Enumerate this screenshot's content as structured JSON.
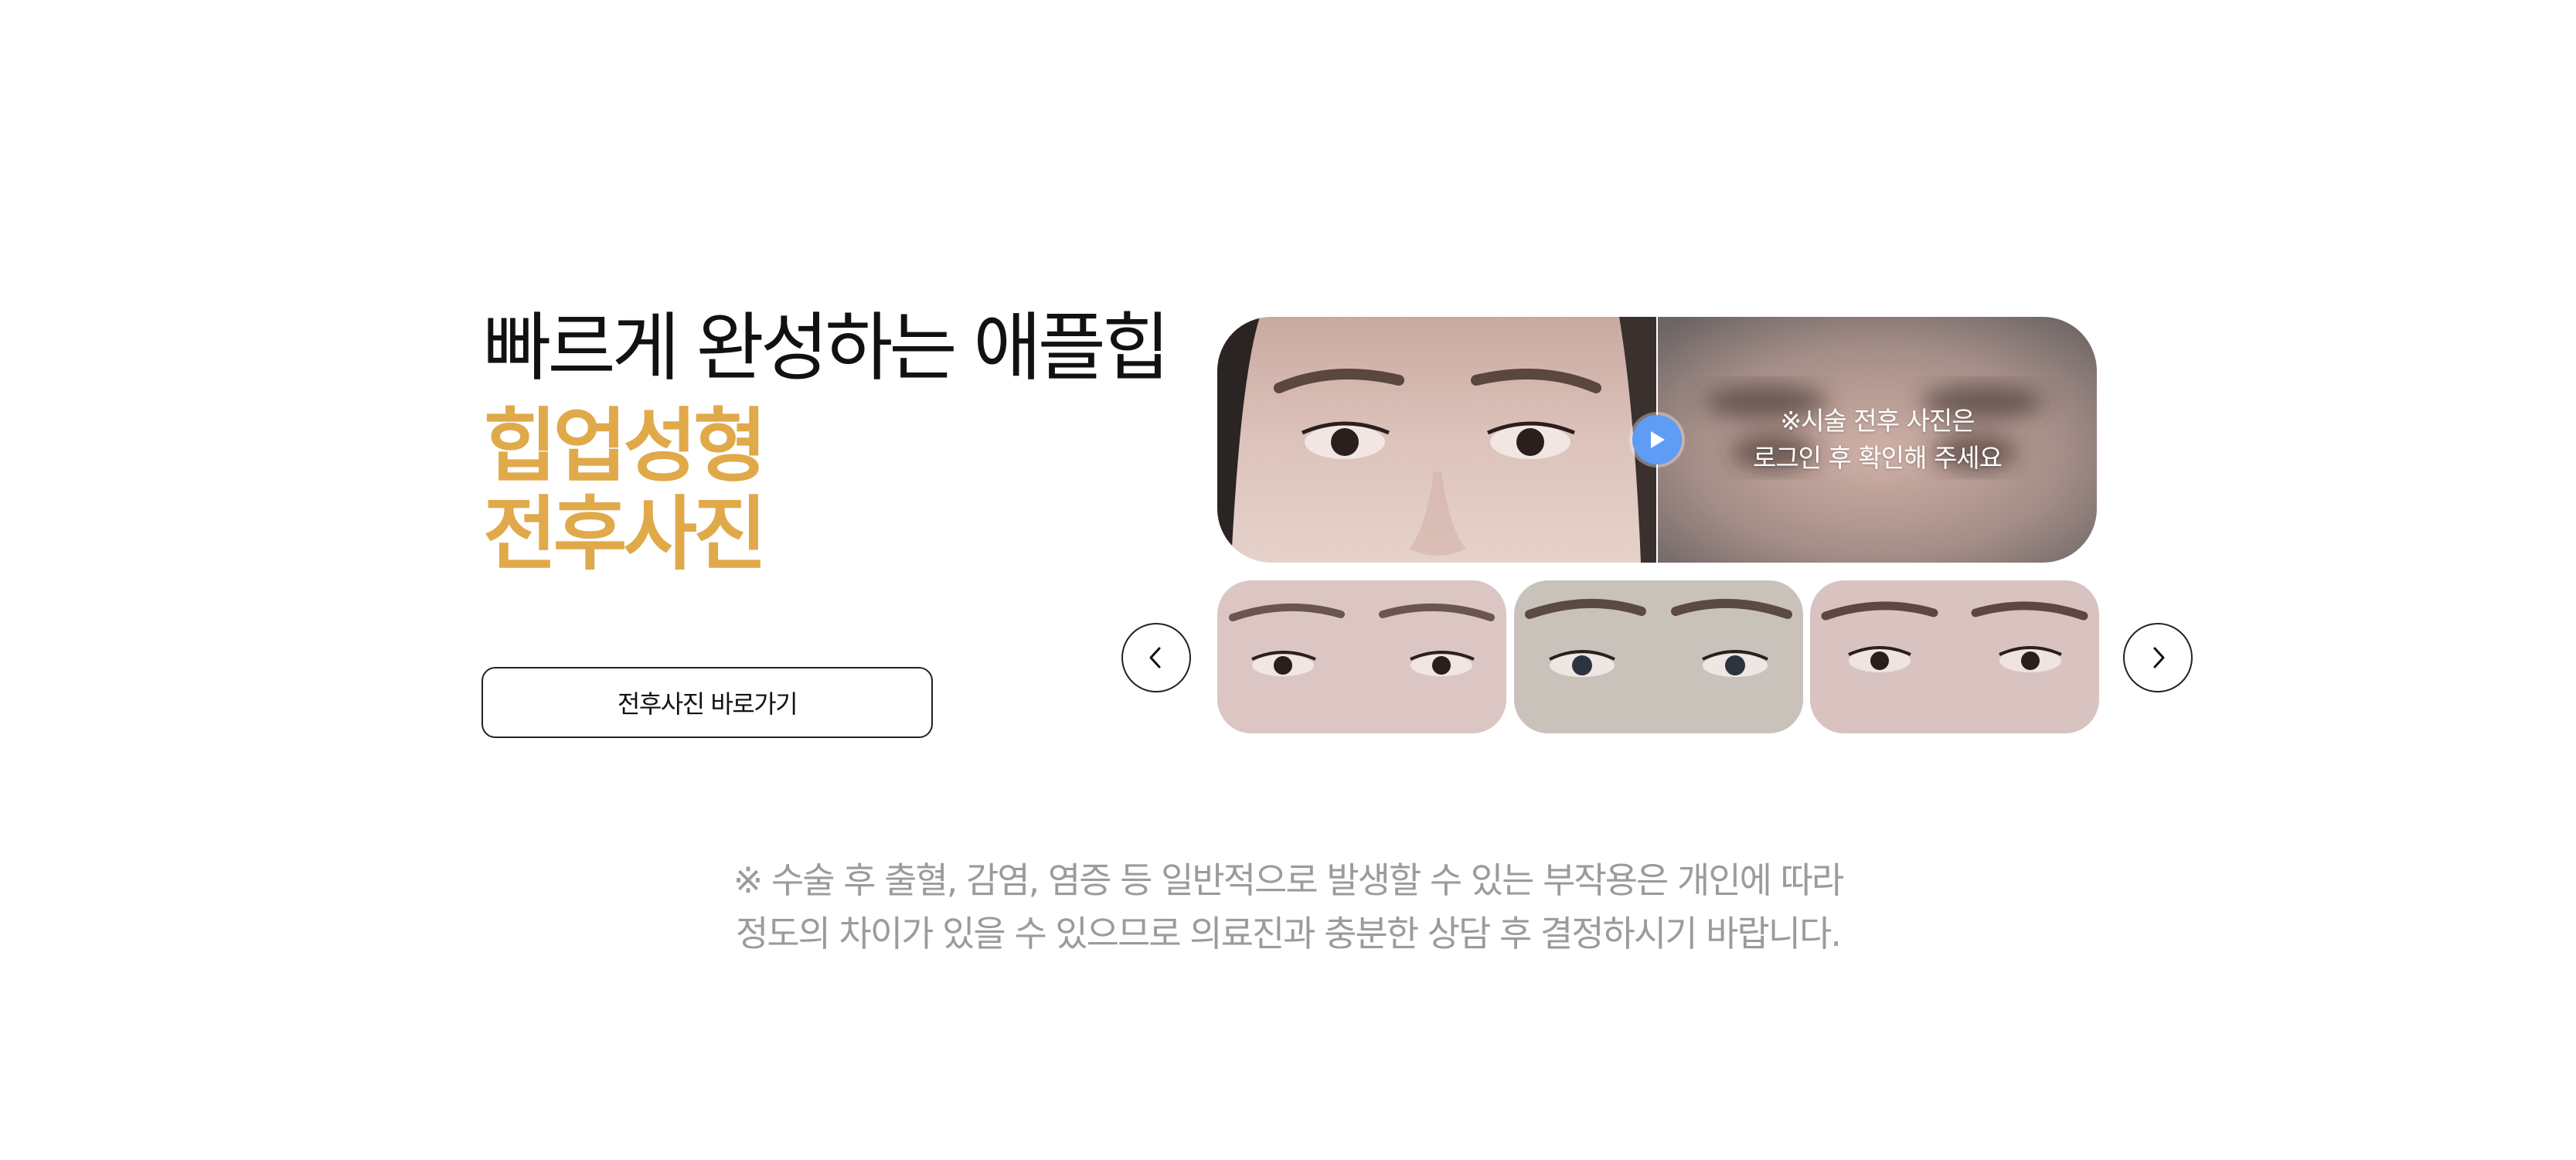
{
  "intro": {
    "title": "빠르게 완성하는 애플힙",
    "subtitle_line1": "힙업성형",
    "subtitle_line2": "전후사진",
    "cta_label": "전후사진 바로가기"
  },
  "gallery": {
    "notice_line1": "※시술 전후 사진은",
    "notice_line2": "로그인 후 확인해 주세요",
    "icons": {
      "play": "play-icon",
      "prev": "chevron-left-icon",
      "next": "chevron-right-icon"
    }
  },
  "disclaimer": {
    "line1": "※ 수술 후 출혈, 감염, 염증 등 일반적으로 발생할 수 있는 부작용은 개인에 따라",
    "line2": "정도의 차이가 있을 수 있으므로 의료진과 충분한 상담 후 결정하시기 바랍니다."
  },
  "colors": {
    "accent": "#e0a94a",
    "play_button": "#5e9cf5",
    "disclaimer_text": "#9b9b9b"
  }
}
